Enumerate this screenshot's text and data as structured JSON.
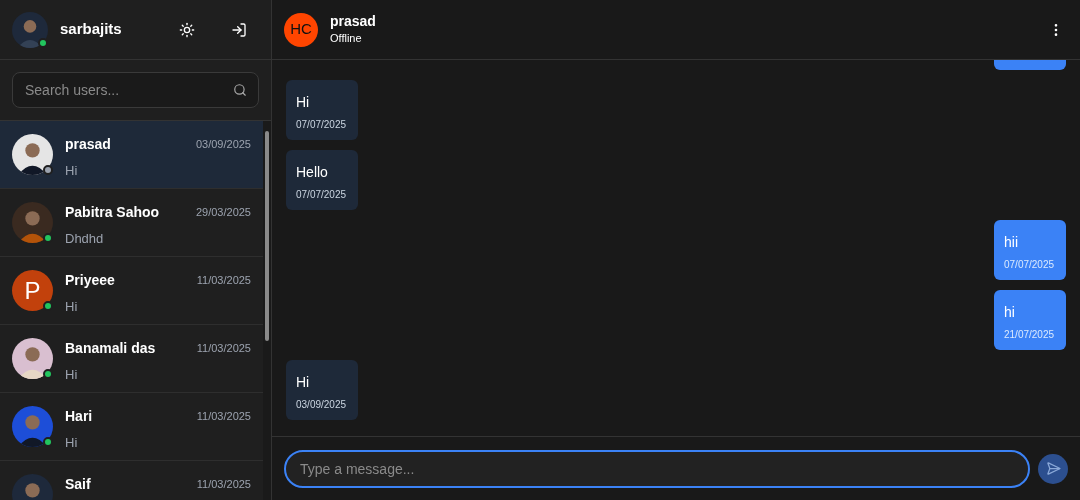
{
  "sidebar": {
    "user": {
      "name": "sarbajits",
      "online": true
    },
    "search": {
      "placeholder": "Search users..."
    },
    "contacts": [
      {
        "name": "prasad",
        "date": "03/09/2025",
        "last_message": "Hi",
        "online": false,
        "selected": true
      },
      {
        "name": "Pabitra Sahoo",
        "date": "29/03/2025",
        "last_message": "Dhdhd",
        "online": true,
        "selected": false
      },
      {
        "name": "Priyeee",
        "date": "11/03/2025",
        "last_message": "Hi",
        "online": true,
        "selected": false,
        "avatar": {
          "kind": "letter",
          "letter": "P",
          "color": "#c2410c"
        }
      },
      {
        "name": "Banamali das",
        "date": "11/03/2025",
        "last_message": "Hi",
        "online": true,
        "selected": false
      },
      {
        "name": "Hari",
        "date": "11/03/2025",
        "last_message": "Hi",
        "online": true,
        "selected": false
      },
      {
        "name": "Saif",
        "date": "11/03/2025",
        "selected": false
      }
    ]
  },
  "chat": {
    "header": {
      "initials": "HC",
      "name": "prasad",
      "status": "Offline"
    },
    "messages": [
      {
        "sent": true,
        "cut_off": true
      },
      {
        "sent": false,
        "text": "Hi",
        "date": "07/07/2025"
      },
      {
        "sent": false,
        "text": "Hello",
        "date": "07/07/2025"
      },
      {
        "sent": true,
        "text": "hii",
        "date": "07/07/2025"
      },
      {
        "sent": true,
        "text": "hi",
        "date": "21/07/2025"
      },
      {
        "sent": false,
        "text": "Hi",
        "date": "03/09/2025"
      }
    ],
    "composer": {
      "placeholder": "Type a message..."
    }
  }
}
